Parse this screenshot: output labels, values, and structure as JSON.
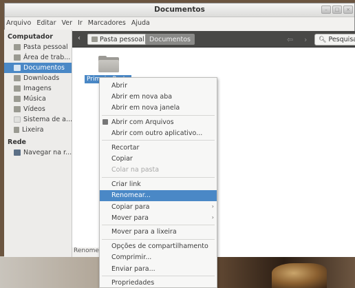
{
  "window": {
    "title": "Documentos"
  },
  "menubar": [
    "Arquivo",
    "Editar",
    "Ver",
    "Ir",
    "Marcadores",
    "Ajuda"
  ],
  "toolbar": {
    "crumb_home": "Pasta pessoal",
    "crumb_current": "Documentos",
    "search_label": "Pesquisa"
  },
  "sidebar": {
    "section_computer": "Computador",
    "computer_items": [
      {
        "label": "Pasta pessoal"
      },
      {
        "label": "Área de trab..."
      },
      {
        "label": "Documentos"
      },
      {
        "label": "Downloads"
      },
      {
        "label": "Imagens"
      },
      {
        "label": "Música"
      },
      {
        "label": "Vídeos"
      },
      {
        "label": "Sistema de a..."
      },
      {
        "label": "Lixeira"
      }
    ],
    "section_network": "Rede",
    "network_items": [
      {
        "label": "Navegar na r..."
      }
    ]
  },
  "content": {
    "folder_label": "PrimeiraPasta",
    "status_text": "Renomei"
  },
  "context_menu": {
    "items": [
      "Abrir",
      "Abrir em nova aba",
      "Abrir em nova janela",
      "Abrir com Arquivos",
      "Abrir com outro aplicativo...",
      "Recortar",
      "Copiar",
      "Colar na pasta",
      "Criar link",
      "Renomear...",
      "Copiar para",
      "Mover para",
      "Mover para a lixeira",
      "Opções de compartilhamento",
      "Comprimir...",
      "Enviar para...",
      "Propriedades"
    ],
    "highlighted": "Renomear...",
    "disabled": [
      "Colar na pasta"
    ]
  },
  "colors": {
    "accent": "#4a88c6",
    "toolbar_bg": "#484846"
  }
}
